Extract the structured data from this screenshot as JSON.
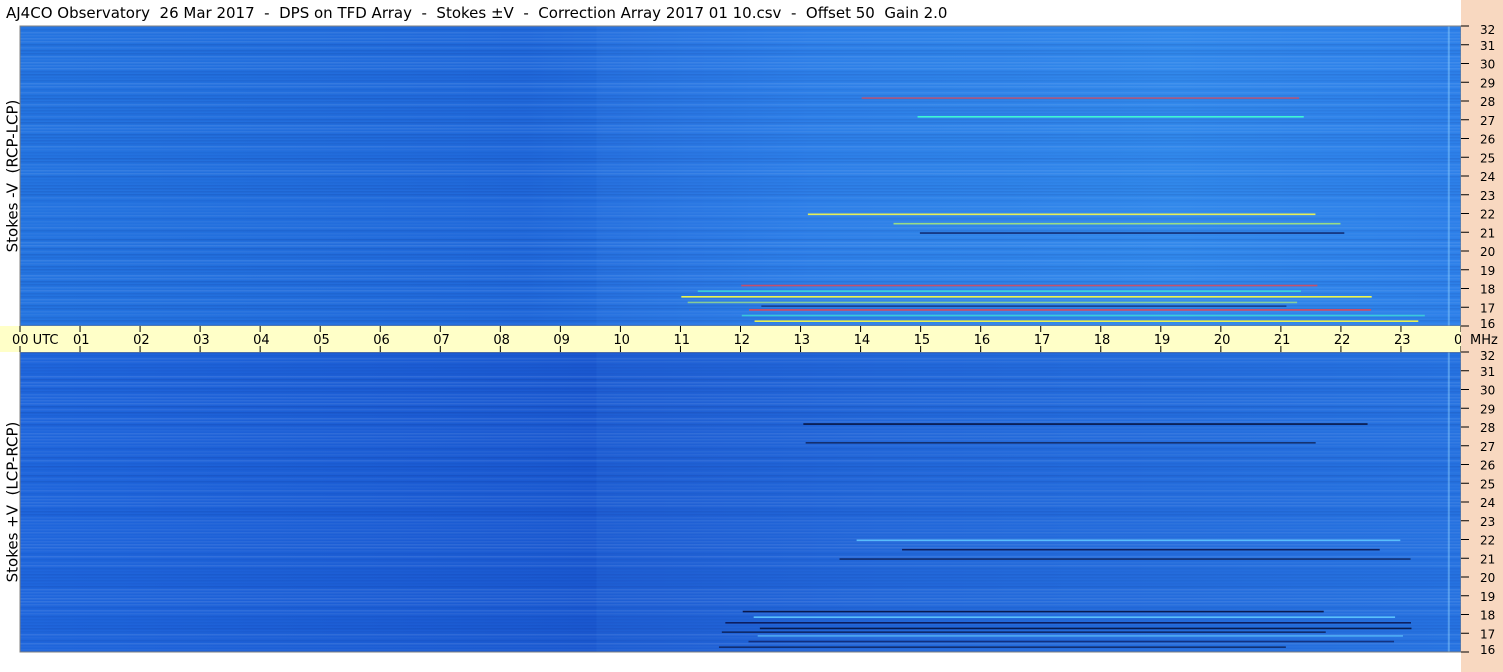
{
  "title": "AJ4CO Observatory  26 Mar 2017  -  DPS on TFD Array  -  Stokes ±V  -  Correction Array 2017 01 10.csv  -  Offset 50  Gain 2.0",
  "colors": {
    "axis_band": "#ffffc8",
    "freq_band": "#f8d8c0",
    "field_top": "#2a78e4",
    "field_bottom": "#1e64d8",
    "grid_border": "#808080"
  },
  "chart_data": [
    {
      "type": "heatmap",
      "panel": "top",
      "ylabel": "Stokes -V  (RCP-LCP)",
      "xlabel": "",
      "x_range_hours": [
        0,
        24
      ],
      "y_range_mhz": [
        16,
        32
      ],
      "yticks": [
        "16",
        "17",
        "18",
        "19",
        "20",
        "21",
        "22",
        "23",
        "24",
        "25",
        "26",
        "27",
        "28",
        "29",
        "30",
        "31",
        "32"
      ],
      "colormap": "blue field with cyan/yellow/red streaks for strong signal"
    },
    {
      "type": "heatmap",
      "panel": "bottom",
      "ylabel": "Stokes +V  (LCP-RCP)",
      "xlabel": "",
      "x_range_hours": [
        0,
        24
      ],
      "y_range_mhz": [
        16,
        32
      ],
      "yticks": [
        "16",
        "17",
        "18",
        "19",
        "20",
        "21",
        "22",
        "23",
        "24",
        "25",
        "26",
        "27",
        "28",
        "29",
        "30",
        "31",
        "32"
      ],
      "colormap": "blue field with dark navy streaks for negative signal"
    }
  ],
  "x_axis": {
    "first_label": "00  UTC",
    "last_label": "00",
    "unit": "MHz",
    "hour_labels": [
      "01",
      "02",
      "03",
      "04",
      "05",
      "06",
      "07",
      "08",
      "09",
      "10",
      "11",
      "12",
      "13",
      "14",
      "15",
      "16",
      "17",
      "18",
      "19",
      "20",
      "21",
      "22",
      "23"
    ]
  }
}
